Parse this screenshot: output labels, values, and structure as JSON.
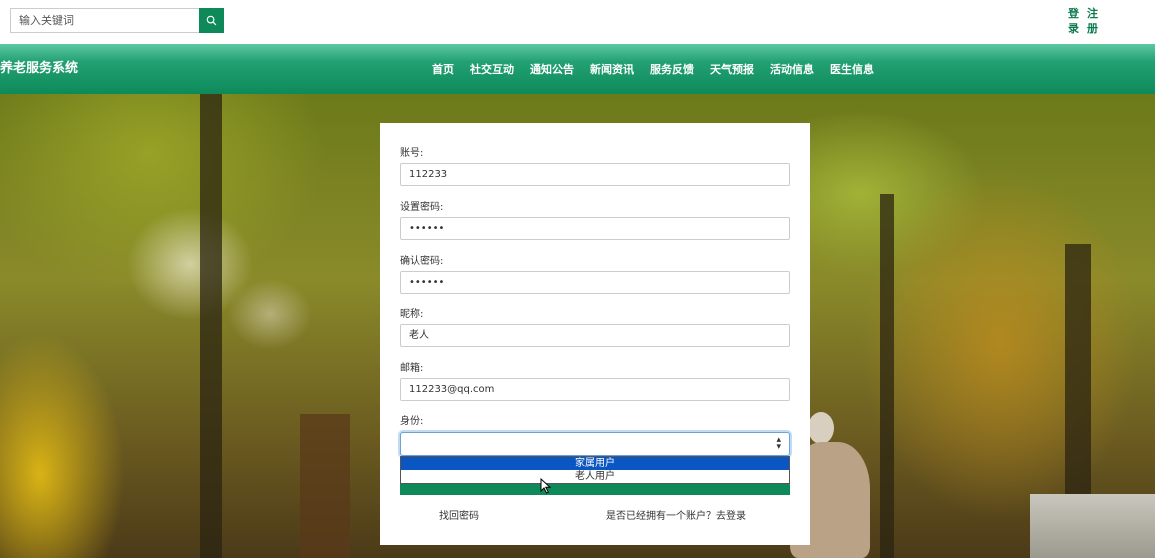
{
  "header": {
    "search_placeholder": "输入关键词",
    "login": [
      "登",
      "录"
    ],
    "register": [
      "注",
      "册"
    ]
  },
  "navbar": {
    "brand": "养老服务系统",
    "items": [
      "首页",
      "社交互动",
      "通知公告",
      "新闻资讯",
      "服务反馈",
      "天气预报",
      "活动信息",
      "医生信息"
    ]
  },
  "form": {
    "account_label": "账号:",
    "account_value": "112233",
    "password_label": "设置密码:",
    "password_value": "••••••",
    "confirm_label": "确认密码:",
    "confirm_value": "••••••",
    "nickname_label": "昵称:",
    "nickname_value": "老人",
    "email_label": "邮箱:",
    "email_value": "112233@qq.com",
    "role_label": "身份:",
    "role_value": "",
    "role_options": [
      "家属用户",
      "老人用户"
    ],
    "forgot_link": "找回密码",
    "login_link": "是否已经拥有一个账户？去登录"
  },
  "colors": {
    "accent": "#0e8a5a",
    "option_highlight": "#0a56c2"
  }
}
